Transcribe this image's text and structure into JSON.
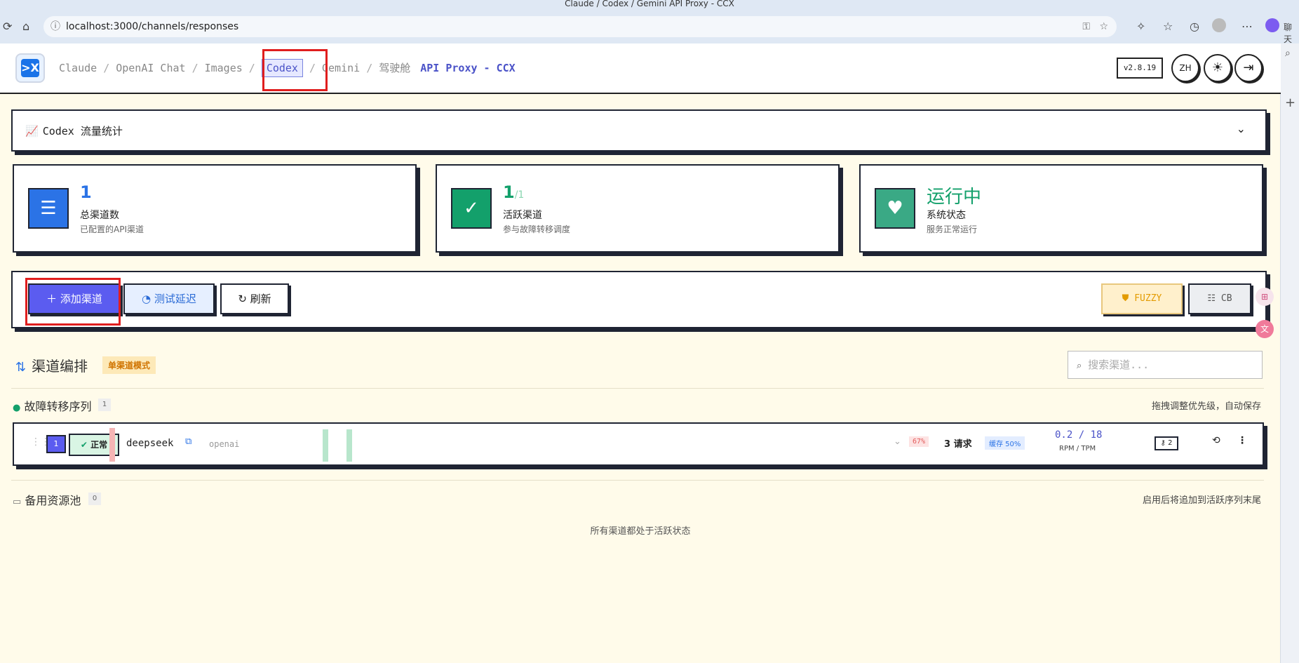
{
  "browser": {
    "window_title": "Claude / Codex / Gemini API Proxy - CCX",
    "url": "localhost:3000/channels/responses",
    "side_label": "聊天"
  },
  "header": {
    "logo_text": ">X",
    "nav": [
      {
        "label": "Claude",
        "active": false
      },
      {
        "label": "OpenAI Chat",
        "active": false
      },
      {
        "label": "Images",
        "active": false
      },
      {
        "label": "Codex",
        "active": true
      },
      {
        "label": "Gemini",
        "active": false
      },
      {
        "label": "驾驶舱",
        "active": false
      }
    ],
    "brand": "API Proxy - CCX",
    "version": "v2.8.19",
    "lang": "ZH"
  },
  "stats_panel": {
    "title": "Codex 流量统计"
  },
  "stats": [
    {
      "value": "1",
      "suffix": "",
      "label": "总渠道数",
      "sub": "已配置的API渠道",
      "color": "#2b73e6"
    },
    {
      "value": "1",
      "suffix": "/1",
      "label": "活跃渠道",
      "sub": "参与故障转移调度",
      "color": "#13a06b"
    },
    {
      "value": "运行中",
      "suffix": "",
      "label": "系统状态",
      "sub": "服务正常运行",
      "color": "#13a06b"
    }
  ],
  "toolbar": {
    "add_label": "添加渠道",
    "test_label": "测试延迟",
    "refresh_label": "刷新",
    "fuzzy_label": "FUZZY",
    "cb_label": "CB"
  },
  "orchestration": {
    "title": "渠道编排",
    "mode_badge": "单渠道模式",
    "search_placeholder": "搜索渠道...",
    "failover": {
      "title": "故障转移序列",
      "count": "1",
      "hint": "拖拽调整优先级，自动保存"
    },
    "channels": [
      {
        "index": "1",
        "status": "正常",
        "name": "deepseek",
        "type": "openai",
        "error_rate": "67%",
        "requests": "3 请求",
        "cache_label": "缓存 50%",
        "rpm_tpm": "0.2 / 18",
        "rpm_tpm_label": "RPM / TPM",
        "keys": "2"
      }
    ],
    "backup": {
      "title": "备用资源池",
      "count": "0",
      "hint": "启用后将追加到活跃序列末尾",
      "empty": "所有渠道都处于活跃状态"
    }
  }
}
